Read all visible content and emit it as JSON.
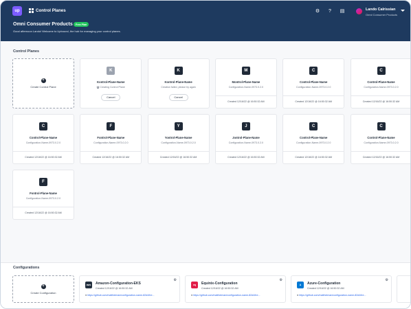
{
  "header": {
    "logo": "up",
    "app_switcher_label": "Control Planes",
    "icons": [
      "gear-icon",
      "help-icon",
      "store-icon"
    ],
    "user": {
      "name": "Lando Calrissian",
      "org": "Omni Consumer Products"
    }
  },
  "hero": {
    "org_title": "Omni Consumer Products",
    "plan_badge": "Free Plan",
    "greeting": "Good afternoon Lando! Welcome to Upbound, the hub for managing your control planes."
  },
  "control_planes": {
    "section_title": "Control Planes",
    "create_label": "Create Control Plane",
    "items": [
      {
        "letter": "K",
        "name": "Kontrol-Plane-Name",
        "status": "creating",
        "sub": "Creating Control Plane",
        "button": "Cancel"
      },
      {
        "letter": "K",
        "name": "Kontrol-Plane-Name",
        "status": "failed",
        "sub": "Creation failed, please try again",
        "button": "Cancel"
      },
      {
        "letter": "M",
        "name": "Montrol-Plane-Name",
        "status": "error",
        "sub": "Configuration-Name-0973.0.2.0",
        "created": "Created 12/16/22 @ 16:50:32 AM"
      },
      {
        "letter": "C",
        "name": "Control-Plane-Name",
        "status": "ok",
        "sub": "Configuration-Name-0973.0.2.0",
        "created": "Created 12/16/22 @ 16:50:32 AM"
      },
      {
        "letter": "C",
        "name": "Control-Plane-Name",
        "status": "ok",
        "sub": "Configuration-Name-0973.0.2.0",
        "created": "Created 12/16/22 @ 16:50:32 AM"
      },
      {
        "letter": "C",
        "name": "Control-Plane-Name",
        "status": "ok",
        "sub": "Configuration-Name-0973.0.2.0",
        "created": "Created 12/16/22 @ 16:50:32 AM"
      },
      {
        "letter": "F",
        "name": "Fontrol-Plane-Name",
        "status": "ok",
        "sub": "Configuration-Name-0973.0.2.0",
        "created": "Created 12/16/22 @ 16:50:32 AM"
      },
      {
        "letter": "Y",
        "name": "Yontrol-Plane-Name",
        "status": "ok",
        "sub": "Configuration-Name-0973.0.2.0",
        "created": "Created 12/16/22 @ 16:50:32 AM"
      },
      {
        "letter": "J",
        "name": "Jontrol-Plane-Name",
        "status": "ok",
        "sub": "Configuration-Name-0973.0.2.0",
        "created": "Created 12/16/22 @ 16:50:32 AM"
      },
      {
        "letter": "C",
        "name": "Control-Plane-Name",
        "status": "ok",
        "sub": "Configuration-Name-0973.0.2.0",
        "created": "Created 12/16/22 @ 16:50:32 AM"
      },
      {
        "letter": "C",
        "name": "Control-Plane-Name",
        "status": "ok",
        "sub": "Configuration-Name-0973.0.2.0",
        "created": "Created 12/16/22 @ 16:50:32 AM"
      },
      {
        "letter": "F",
        "name": "Fontrol-Plane-Name",
        "status": "ok",
        "sub": "Configuration-Name-0973.0.2.0",
        "created": "Created 12/16/22 @ 16:50:32 AM"
      }
    ]
  },
  "configurations": {
    "section_title": "Configurations",
    "create_label": "Create Configuration",
    "items": [
      {
        "logo": "aws",
        "logo_color": "#232f3e",
        "name": "Amazon-Configuration-EKS",
        "created": "Created 12/16/22 @ 16:50:32 AM",
        "url": "https://github.com/mattheiman/configuration-name-82d4/tre..."
      },
      {
        "logo": "eq",
        "logo_color": "#e11d48",
        "name": "Equinix-Configuration",
        "created": "Created 12/16/22 @ 16:50:32 AM",
        "url": "https://github.com/mattheiman/configuration-name-82d4/tre..."
      },
      {
        "logo": "A",
        "logo_color": "#0078d4",
        "name": "Azure-Configuration",
        "created": "Created 12/16/22 @ 16:50:32 AM",
        "url": "https://github.com/mattheiman/configuration-name-82d4/tre..."
      }
    ]
  },
  "colors": {
    "header_bg": "#1e3a5f",
    "success": "#22c55e",
    "error": "#ef4444",
    "brand": "#7c5cff"
  }
}
